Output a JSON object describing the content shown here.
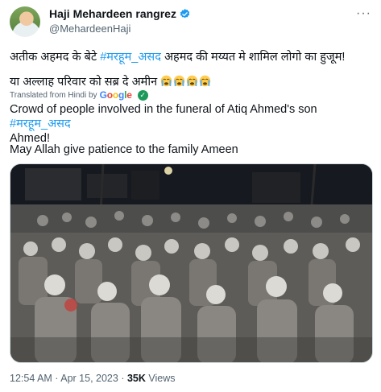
{
  "tweet": {
    "display_name": "Haji Mehardeen rangrez",
    "handle": "@MehardeenHaji",
    "original_line1_before": "अतीक अहमद के बेटे ",
    "original_hashtag": "#मरहूम_असद",
    "original_line1_after": " अहमद की मय्यत मे शामिल लोगो का हुजूम!",
    "original_line2": "या अल्लाह परिवार को सब्र दे अमीन ",
    "translated_from": "Translated from Hindi by",
    "translator": "Google",
    "translated_line1_before": "Crowd of people involved in the funeral of Atiq Ahmed's son ",
    "translated_hashtag": "#मरहूम_असद",
    "translated_line1_after": "Ahmed!",
    "translated_line2": "May Allah give patience to the family Ameen",
    "time": "12:54 AM",
    "separator": " · ",
    "date": "Apr 15, 2023",
    "views_count": "35K",
    "views_label": " Views",
    "more": "···",
    "icons": {
      "verified": "verified-badge-icon",
      "emoji": "crying-face-icon",
      "check": "check-icon"
    },
    "colors": {
      "link": "#1d9bf0",
      "text": "#0f1419",
      "muted": "#536471",
      "verified": "#1d9bf0"
    }
  }
}
